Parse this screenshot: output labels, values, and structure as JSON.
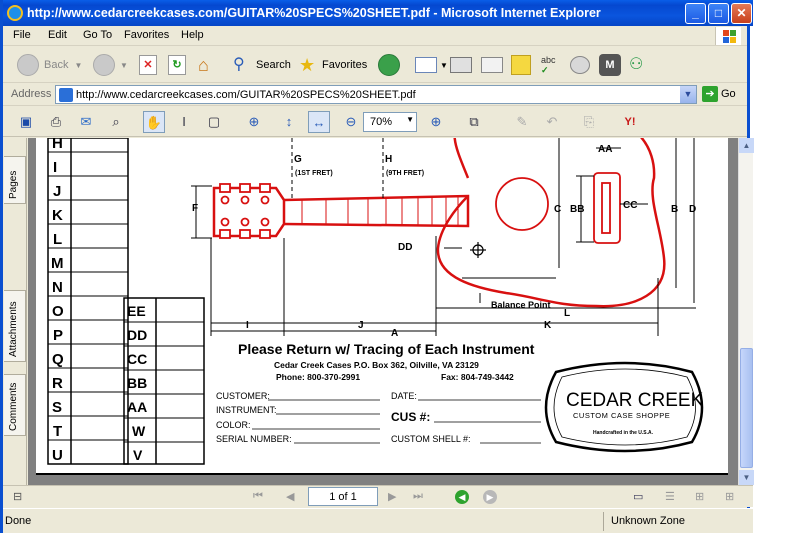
{
  "window": {
    "title": "http://www.cedarcreekcases.com/GUITAR%20SPECS%20SHEET.pdf - Microsoft Internet Explorer",
    "minimize": "_",
    "maximize": "□",
    "close": "✕"
  },
  "menu": {
    "items": [
      "File",
      "Edit",
      "Go To",
      "Favorites",
      "Help"
    ]
  },
  "toolbar": {
    "back_label": "Back",
    "search_label": "Search",
    "favorites_label": "Favorites"
  },
  "address": {
    "label": "Address",
    "url": "http://www.cedarcreekcases.com/GUITAR%20SPECS%20SHEET.pdf",
    "go_label": "Go"
  },
  "pdf_toolbar": {
    "zoom": "70%"
  },
  "left_tabs": [
    "Pages",
    "Attachments",
    "Comments"
  ],
  "document": {
    "row_letters": [
      "H",
      "I",
      "J",
      "K",
      "L",
      "M",
      "N",
      "O",
      "P",
      "Q",
      "R",
      "S",
      "T",
      "U"
    ],
    "double_letters": [
      "EE",
      "DD",
      "CC",
      "BB",
      "AA",
      "W",
      "V"
    ],
    "dim_labels": {
      "g": "G",
      "g_note": "(1ST FRET)",
      "h": "H",
      "h_note": "(9TH FRET)",
      "f": "F",
      "aa": "AA",
      "bb": "BB",
      "cc": "CC",
      "c": "C",
      "b": "B",
      "d": "D",
      "dd": "DD",
      "balance": "Balance Point",
      "l": "L",
      "i": "I",
      "j": "J",
      "a": "A",
      "k": "K"
    },
    "heading": "Please Return w/ Tracing of Each Instrument",
    "company_line": "Cedar Creek Cases  P.O. Box 362, Oilville, VA 23129",
    "phone": "Phone: 800-370-2991",
    "fax": "Fax: 804-749-3442",
    "form": {
      "customer": "CUSTOMER:",
      "date": "DATE:",
      "instrument": "INSTRUMENT:",
      "cus": "CUS #:",
      "color": "COLOR:",
      "serial": "SERIAL NUMBER:",
      "shell": "CUSTOM SHELL #:"
    },
    "logo": {
      "name": "CEDAR CREEK",
      "tagline": "CUSTOM CASE SHOPPE",
      "small": "Handcrafted in the U.S.A."
    }
  },
  "pager": {
    "page_display": "1 of 1"
  },
  "status": {
    "text": "Done",
    "zone": "Unknown Zone"
  },
  "colors": {
    "titlebar": "#0a55de",
    "guitar_red": "#d81010",
    "chrome": "#ece9d8"
  }
}
